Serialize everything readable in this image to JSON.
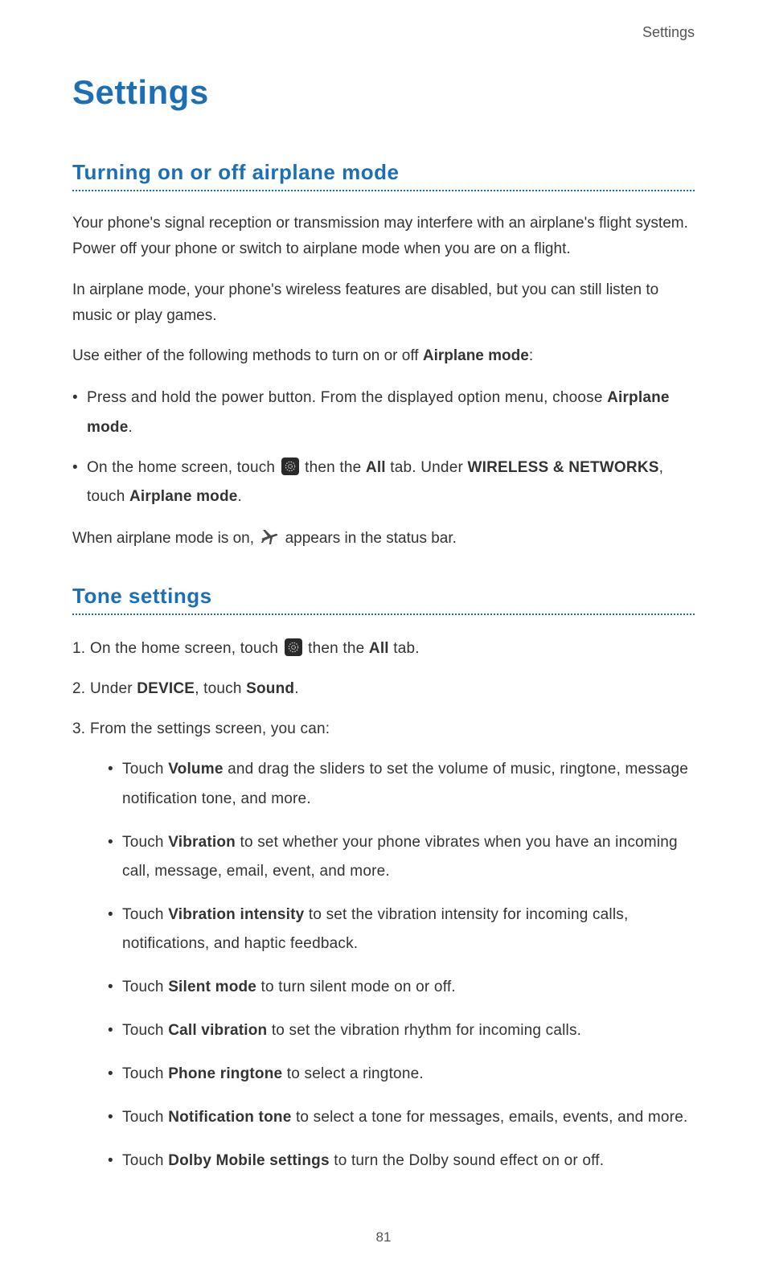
{
  "header": {
    "label": "Settings"
  },
  "title": "Settings",
  "sections": {
    "airplane": {
      "heading": "Turning on or off airplane mode",
      "p1": "Your phone's signal reception or transmission may interfere with an airplane's flight system. Power off your phone or switch to airplane mode when you are on a flight.",
      "p2": "In airplane mode, your phone's wireless features are disabled, but you can still listen to music or play games.",
      "p3_pre": "Use either of the following methods to turn on or off ",
      "p3_bold": "Airplane mode",
      "p3_post": ":",
      "b1_pre": "Press and hold the power button. From the displayed option menu, choose ",
      "b1_bold": "Airplane mode",
      "b1_post": ".",
      "b2_pre": "On the home screen, touch ",
      "b2_mid1": " then the ",
      "b2_bold_all": "All",
      "b2_mid2": " tab. Under ",
      "b2_bold_wn": "WIRELESS & NETWORKS",
      "b2_mid3": ", touch ",
      "b2_bold_am": "Airplane mode",
      "b2_post": ".",
      "p4_pre": "When airplane mode is on, ",
      "p4_post": " appears in the status bar."
    },
    "tone": {
      "heading": "Tone settings",
      "n1_num": "1.",
      "n1_pre": "On the home screen, touch ",
      "n1_mid": " then the ",
      "n1_bold": "All",
      "n1_post": " tab.",
      "n2_num": "2.",
      "n2_pre": "Under ",
      "n2_bold1": "DEVICE",
      "n2_mid": ", touch ",
      "n2_bold2": "Sound",
      "n2_post": ".",
      "n3_num": "3.",
      "n3_text": "From the settings screen, you can:",
      "sub": [
        {
          "pre": "Touch ",
          "bold": "Volume",
          "post": " and drag the sliders to set the volume of music, ringtone, message notification tone, and more."
        },
        {
          "pre": "Touch ",
          "bold": "Vibration",
          "post": " to set whether your phone vibrates when you have an incoming call, message, email, event, and more."
        },
        {
          "pre": "Touch ",
          "bold": "Vibration intensity",
          "post": " to set the vibration intensity for incoming calls, notifications, and haptic feedback."
        },
        {
          "pre": "Touch ",
          "bold": "Silent mode",
          "post": " to turn silent mode on or off."
        },
        {
          "pre": "Touch ",
          "bold": "Call vibration",
          "post": " to set the vibration rhythm for incoming calls."
        },
        {
          "pre": "Touch ",
          "bold": "Phone ringtone",
          "post": " to select a ringtone."
        },
        {
          "pre": "Touch ",
          "bold": "Notification tone",
          "post": " to select a tone for messages, emails, events, and more."
        },
        {
          "pre": "Touch ",
          "bold": "Dolby Mobile settings",
          "post": " to turn the Dolby sound effect on or off."
        }
      ]
    }
  },
  "page_number": "81"
}
